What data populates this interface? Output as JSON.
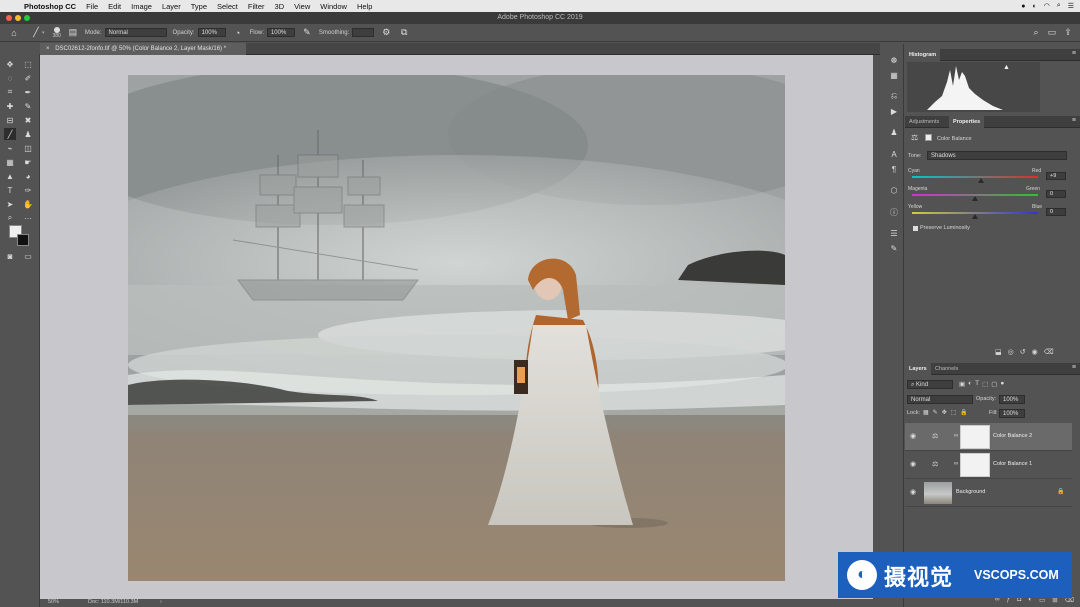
{
  "menubar": {
    "app": "Photoshop CC",
    "items": [
      "File",
      "Edit",
      "Image",
      "Layer",
      "Type",
      "Select",
      "Filter",
      "3D",
      "View",
      "Window",
      "Help"
    ]
  },
  "window": {
    "title": "Adobe Photoshop CC 2019"
  },
  "options": {
    "brush_size": "380",
    "mode_label": "Mode:",
    "mode_value": "Normal",
    "opacity_label": "Opacity:",
    "opacity_value": "100%",
    "flow_label": "Flow:",
    "flow_value": "100%",
    "smoothing_label": "Smoothing:"
  },
  "document": {
    "tab": "DSC02612-2fonfo.tif @ 50% (Color Balance 2, Layer Mask/16) *"
  },
  "status": {
    "zoom": "50%",
    "doc": "Doc: 110.3M/110.3M"
  },
  "panels": {
    "histogram": {
      "tab": "Histogram"
    },
    "properties": {
      "tab_adjustments": "Adjustments",
      "tab_properties": "Properties",
      "title": "Color Balance",
      "tone_label": "Tone:",
      "tone_value": "Shadows",
      "sliders": [
        {
          "left": "Cyan",
          "right": "Red",
          "value": "+9",
          "level": 9
        },
        {
          "left": "Magenta",
          "right": "Green",
          "value": "0",
          "level": 0
        },
        {
          "left": "Yellow",
          "right": "Blue",
          "value": "0",
          "level": 0
        }
      ],
      "preserve_luminosity": "Preserve Luminosity"
    },
    "layers": {
      "tab_layers": "Layers",
      "tab_channels": "Channels",
      "kind": "Kind",
      "blend": "Normal",
      "opacity_label": "Opacity:",
      "opacity_value": "100%",
      "lock_label": "Lock:",
      "fill_label": "Fill:",
      "fill_value": "100%",
      "items": [
        {
          "name": "Color Balance 2"
        },
        {
          "name": "Color Balance 1"
        },
        {
          "name": "Background"
        }
      ]
    }
  },
  "watermark": {
    "cn": "摄视觉",
    "en": "VSCOPS.COM"
  }
}
